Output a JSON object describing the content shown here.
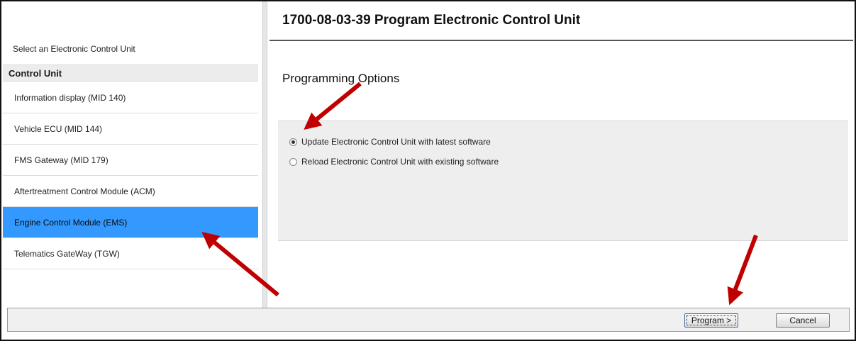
{
  "page_title": "1700-08-03-39 Program Electronic Control Unit",
  "left_panel": {
    "header": "Select an Electronic Control Unit",
    "column_header": "Control Unit",
    "items": [
      {
        "label": "Information display (MID 140)"
      },
      {
        "label": "Vehicle ECU (MID 144)"
      },
      {
        "label": "FMS Gateway (MID 179)"
      },
      {
        "label": "Aftertreatment Control Module (ACM)"
      },
      {
        "label": "Engine Control Module (EMS)",
        "selected": true
      },
      {
        "label": "Telematics GateWay (TGW)"
      }
    ]
  },
  "programming": {
    "section_title": "Programming Options",
    "options": [
      {
        "label": "Update Electronic Control Unit with latest software",
        "checked": true
      },
      {
        "label": "Reload Electronic Control Unit with existing software",
        "checked": false
      }
    ]
  },
  "buttons": {
    "program": "Program >",
    "cancel": "Cancel"
  },
  "colors": {
    "selection": "#3399ff",
    "annotation_arrow": "#c00000"
  }
}
